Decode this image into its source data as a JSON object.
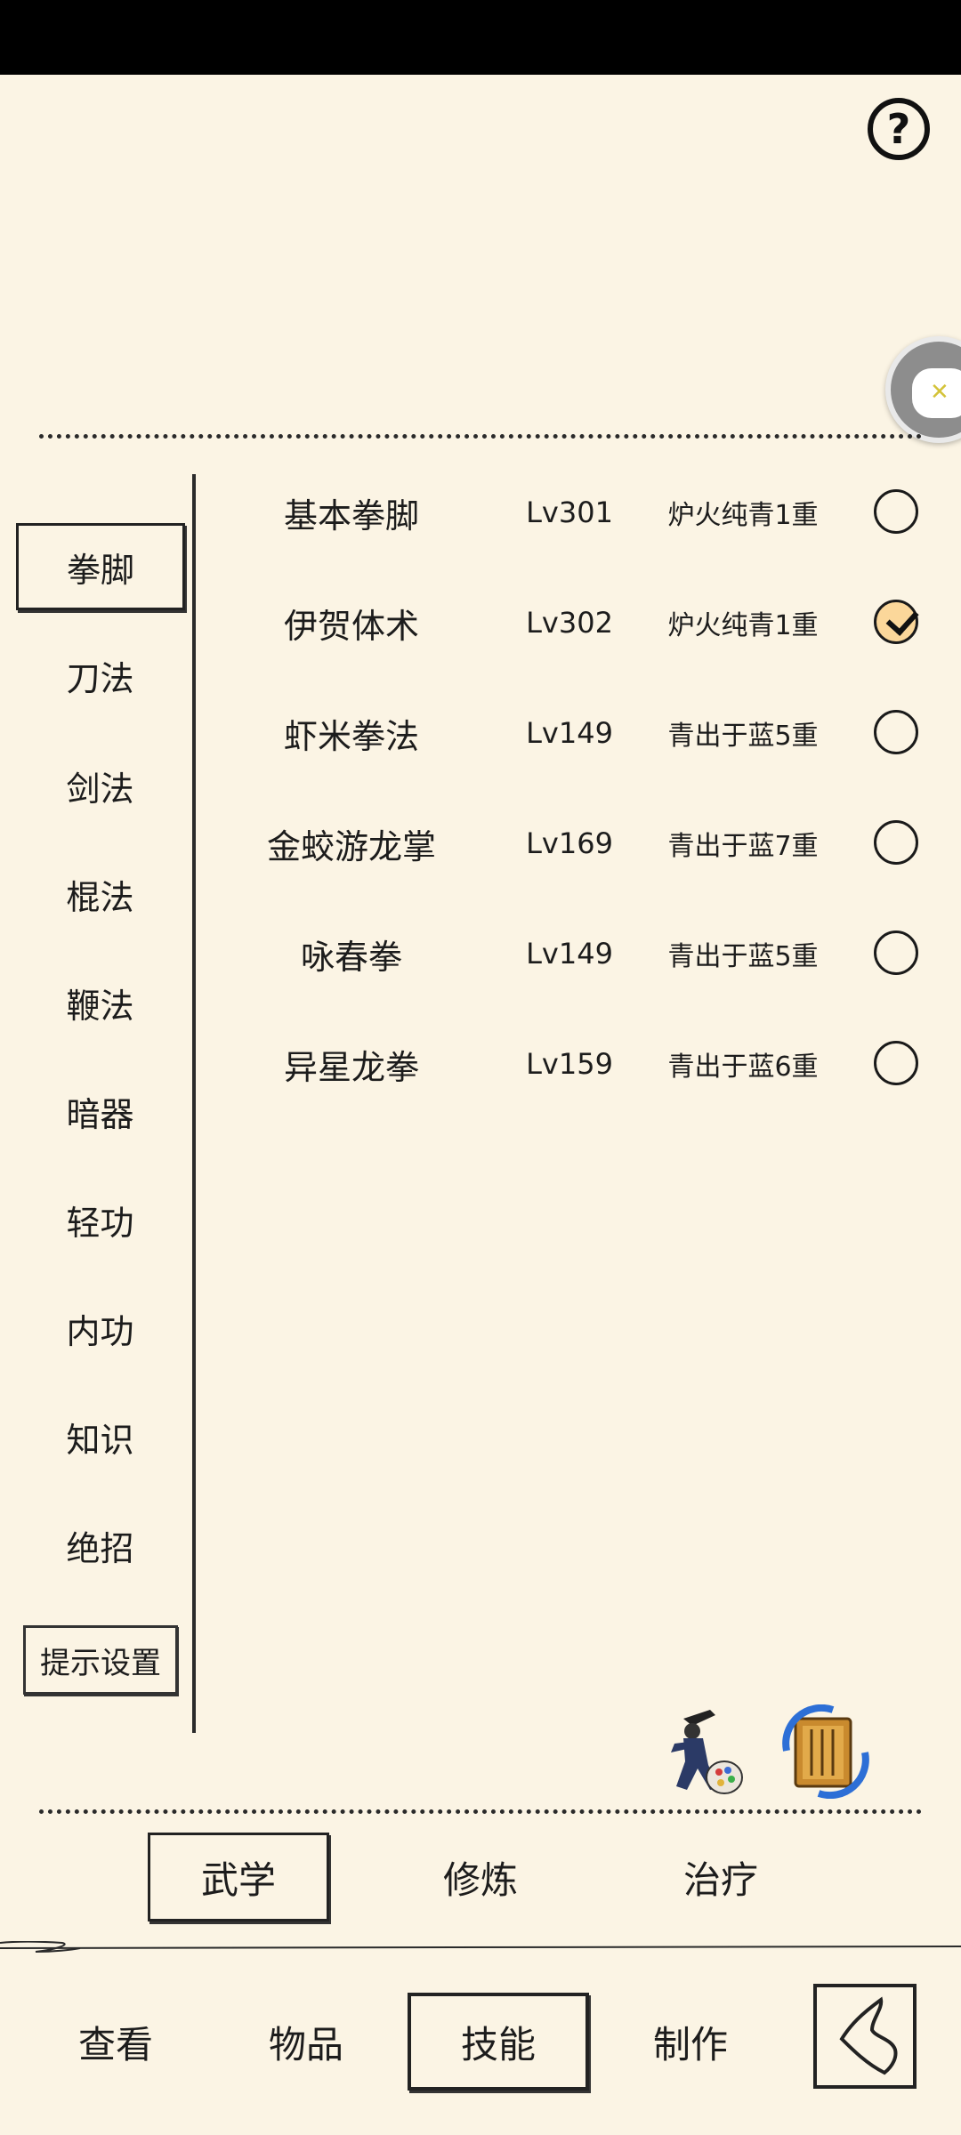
{
  "help": {
    "label": "?"
  },
  "categories": [
    {
      "label": "拳脚",
      "active": true
    },
    {
      "label": "刀法"
    },
    {
      "label": "剑法"
    },
    {
      "label": "棍法"
    },
    {
      "label": "鞭法"
    },
    {
      "label": "暗器"
    },
    {
      "label": "轻功"
    },
    {
      "label": "内功"
    },
    {
      "label": "知识"
    },
    {
      "label": "绝招"
    }
  ],
  "hint_settings": {
    "label": "提示设置"
  },
  "skills": [
    {
      "name": "基本拳脚",
      "level": "Lv301",
      "realm": "炉火纯青1重",
      "checked": false
    },
    {
      "name": "伊贺体术",
      "level": "Lv302",
      "realm": "炉火纯青1重",
      "checked": true
    },
    {
      "name": "虾米拳法",
      "level": "Lv149",
      "realm": "青出于蓝5重",
      "checked": false
    },
    {
      "name": "金蛟游龙掌",
      "level": "Lv169",
      "realm": "青出于蓝7重",
      "checked": false
    },
    {
      "name": "咏春拳",
      "level": "Lv149",
      "realm": "青出于蓝5重",
      "checked": false
    },
    {
      "name": "异星龙拳",
      "level": "Lv159",
      "realm": "青出于蓝6重",
      "checked": false
    }
  ],
  "subtabs": [
    {
      "label": "武学",
      "active": true
    },
    {
      "label": "修炼"
    },
    {
      "label": "治疗"
    }
  ],
  "nav": [
    {
      "label": "查看"
    },
    {
      "label": "物品"
    },
    {
      "label": "技能",
      "active": true
    },
    {
      "label": "制作"
    }
  ],
  "icons": {
    "help": "question-circle-icon",
    "float": "gamepad-icon",
    "martial_tool": "fighter-palette-icon",
    "switch_tool": "scroll-switch-icon",
    "back": "back-arrow-icon"
  }
}
